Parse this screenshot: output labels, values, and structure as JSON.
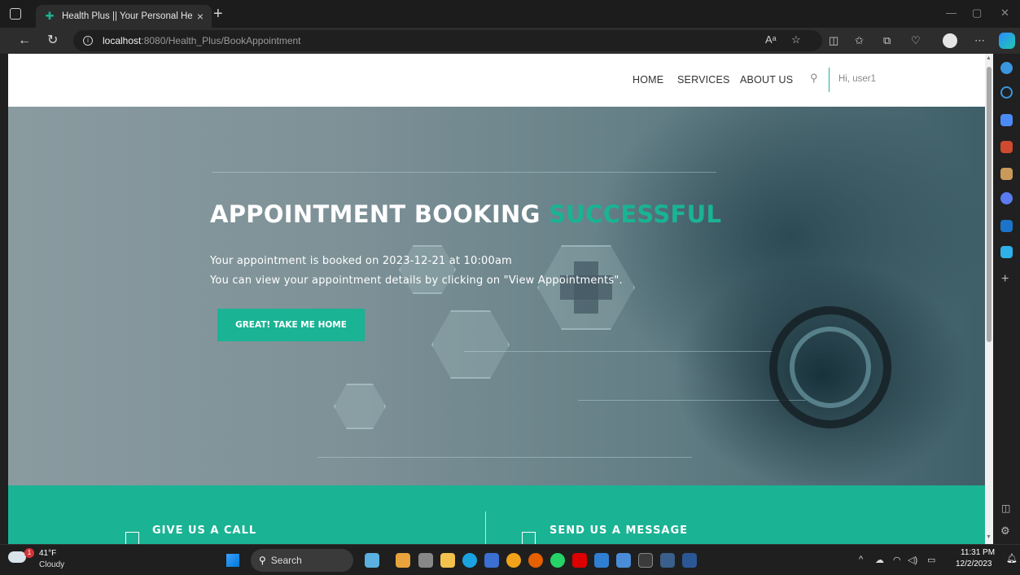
{
  "browser": {
    "tab_title": "Health Plus || Your Personal Healt",
    "tab_close": "×",
    "new_tab": "+",
    "url_host": "localhost",
    "url_path": ":8080/Health_Plus/BookAppointment"
  },
  "site": {
    "nav": [
      "HOME",
      "SERVICES",
      "ABOUT US"
    ],
    "user_greeting": "Hi, user1"
  },
  "hero": {
    "title_main": "APPOINTMENT BOOKING",
    "title_accent": "SUCCESSFUL",
    "line1": "Your appointment is booked on 2023-12-21 at 10:00am",
    "line2": "You can view your appointment details by clicking on \"View Appointments\".",
    "button": "GREAT! TAKE ME HOME"
  },
  "contact": {
    "call": "GIVE US A CALL",
    "message": "SEND US A MESSAGE"
  },
  "taskbar": {
    "temperature": "41°F",
    "condition": "Cloudy",
    "weather_badge": "1",
    "search": "Search",
    "time": "11:31 PM",
    "date": "12/2/2023"
  },
  "colors": {
    "accent": "#1ab394"
  }
}
